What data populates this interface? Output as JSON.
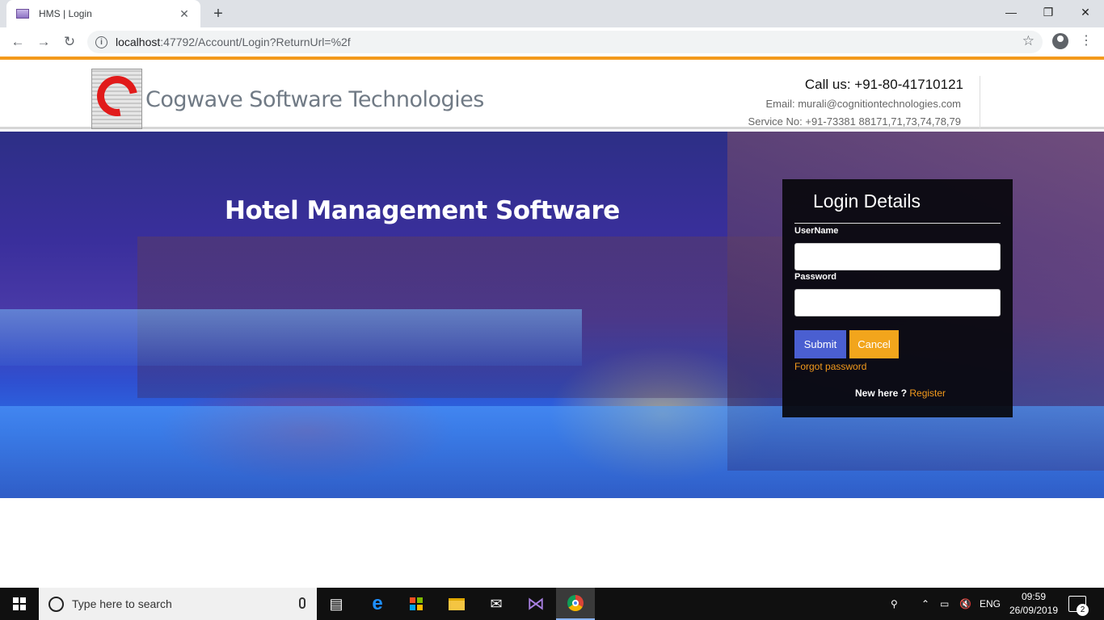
{
  "browser": {
    "tab_title": "HMS | Login",
    "tab_close": "✕",
    "new_tab": "+",
    "url_host": "localhost",
    "url_rest": ":47792/Account/Login?ReturnUrl=%2f",
    "minimize": "—",
    "restore": "❐",
    "close": "✕"
  },
  "header": {
    "company_name": "Cogwave Software Technologies",
    "call_us": "Call us: +91-80-41710121",
    "email": "Email: murali@cognitiontechnologies.com",
    "service": "Service No: +91-73381 88171,71,73,74,78,79"
  },
  "hero": {
    "title": "Hotel Management Software"
  },
  "login": {
    "title": "Login Details",
    "username_label": "UserName",
    "username_value": "",
    "password_label": "Password",
    "password_value": "",
    "submit_label": "Submit",
    "cancel_label": "Cancel",
    "forgot_label": "Forgot password",
    "new_here": "New here ? ",
    "register_label": "Register"
  },
  "taskbar": {
    "search_placeholder": "Type here to search",
    "language": "ENG",
    "time": "09:59",
    "date": "26/09/2019",
    "notification_count": "2"
  },
  "colors": {
    "accent_orange": "#f39a1c",
    "submit_blue": "#4a5fd1",
    "cancel_orange": "#f2a51c"
  }
}
